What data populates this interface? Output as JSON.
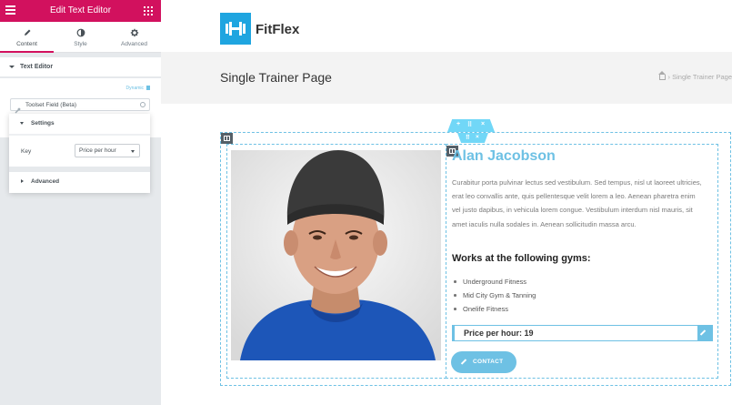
{
  "editor": {
    "title": "Edit Text Editor",
    "tabs": [
      {
        "label": "Content",
        "icon": "pencil-icon"
      },
      {
        "label": "Style",
        "icon": "contrast-icon"
      },
      {
        "label": "Advanced",
        "icon": "gear-icon"
      }
    ],
    "section_title": "Text Editor",
    "dynamic_label": "Dynamic",
    "tag_field_value": "Toolset Field (Beta)",
    "popover": {
      "settings_title": "Settings",
      "key_label": "Key",
      "key_value": "Price per hour",
      "advanced_title": "Advanced"
    },
    "accent_color": "#d2115e"
  },
  "site": {
    "logo_text": "FitFlex",
    "logo_color": "#1fa5e0",
    "page_title": "Single Trainer Page",
    "breadcrumb_current": "Single Trainer Page"
  },
  "trainer": {
    "name": "Alan Jacobson",
    "bio": "Curabitur porta pulvinar lectus sed vestibulum. Sed tempus, nisl ut laoreet ultricies, erat leo convallis ante, quis pellentesque velit lorem a leo. Aenean pharetra enim vel justo dapibus, in vehicula lorem congue. Vestibulum interdum nisl mauris, sit amet iaculis nulla sodales in. Aenean sollicitudin massa arcu.",
    "gyms_heading": "Works at the following gyms:",
    "gyms": [
      "Underground Fitness",
      "Mid City Gym & Tanning",
      "Onelife Fitness"
    ],
    "price_text": "Price per hour: 19",
    "contact_label": "CONTACT",
    "accent_color": "#6ec1e4"
  },
  "handles": {
    "section": [
      "+",
      "⠿",
      "×"
    ],
    "inner": [
      "⠿",
      "×"
    ]
  }
}
